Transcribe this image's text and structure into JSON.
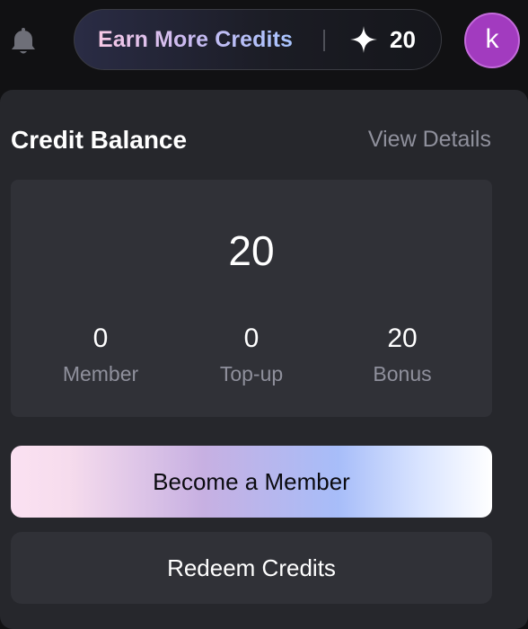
{
  "header": {
    "earn_label": "Earn More Credits",
    "credit_count": "20",
    "avatar_initial": "k"
  },
  "panel": {
    "title": "Credit Balance",
    "view_details": "View Details",
    "total": "20",
    "stats": [
      {
        "value": "0",
        "label": "Member"
      },
      {
        "value": "0",
        "label": "Top-up"
      },
      {
        "value": "20",
        "label": "Bonus"
      }
    ],
    "become_member_label": "Become a Member",
    "redeem_label": "Redeem Credits"
  },
  "colors": {
    "avatar": "#a23bbf",
    "panel_bg": "#26272c",
    "card_bg": "#303137",
    "muted_text": "#8f909c"
  },
  "icons": [
    "bell-icon",
    "sparkle-icon"
  ]
}
